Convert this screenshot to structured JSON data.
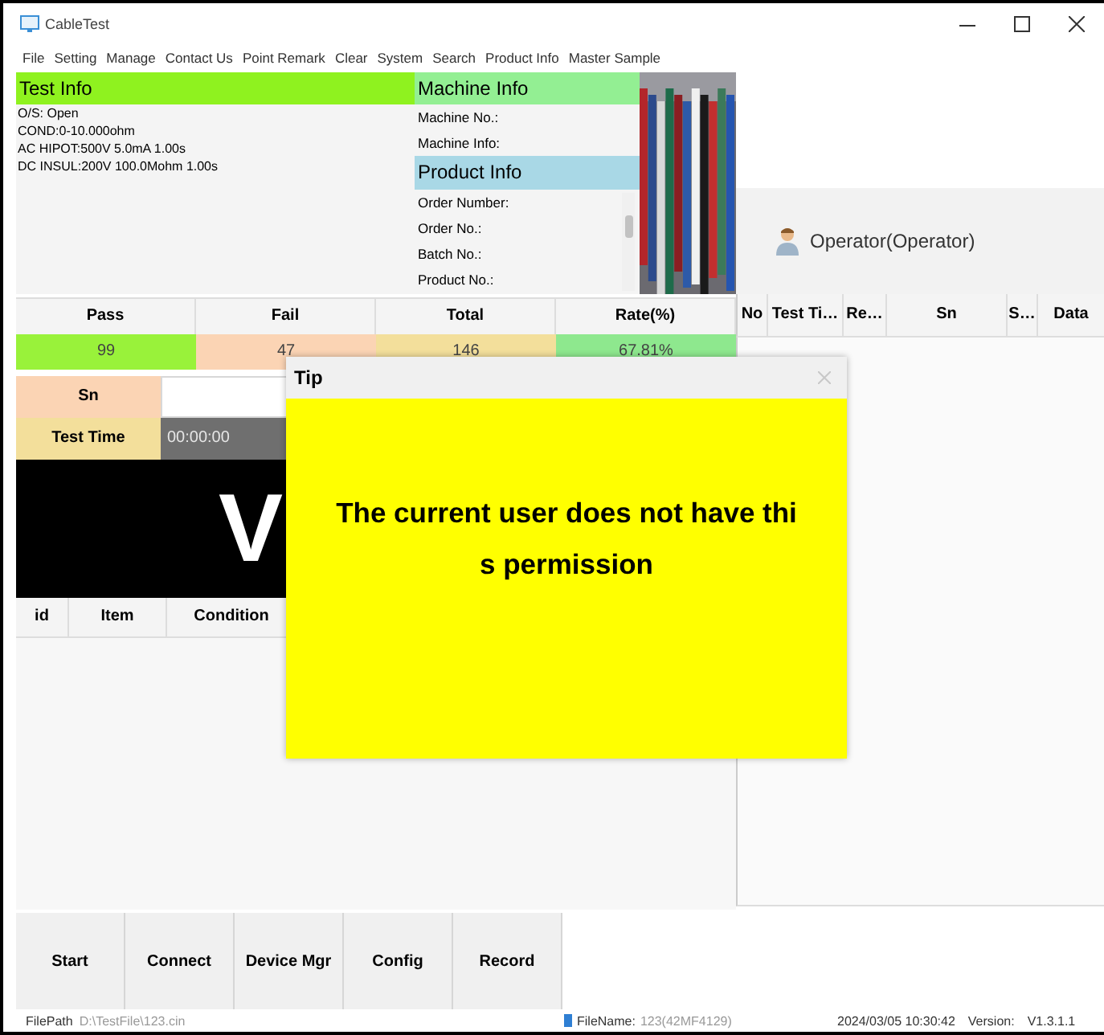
{
  "window": {
    "title": "CableTest"
  },
  "menu": [
    "File",
    "Setting",
    "Manage",
    "Contact Us",
    "Point Remark",
    "Clear",
    "System",
    "Search",
    "Product Info",
    "Master Sample"
  ],
  "test_info": {
    "title": "Test Info",
    "lines": [
      "O/S: Open",
      "COND:0-10.000ohm",
      "AC HIPOT:500V 5.0mA 1.00s",
      "DC INSUL:200V 100.0Mohm 1.00s"
    ]
  },
  "machine_info": {
    "title": "Machine Info",
    "lines": [
      "Machine No.:",
      "Machine Info:"
    ]
  },
  "product_info": {
    "title": "Product Info",
    "lines": [
      "Order Number:",
      "Order No.:",
      "Batch No.:",
      "Product No.:"
    ]
  },
  "photo": {
    "kind": "picture"
  },
  "operator": "Operator(Operator)",
  "stats": {
    "columns": [
      "Pass",
      "Fail",
      "Total",
      "Rate(%)"
    ],
    "values": [
      {
        "text": "99",
        "color": "#99f23a"
      },
      {
        "text": "47",
        "color": "#fbd4b4"
      },
      {
        "text": "146",
        "color": "#f3df9b"
      },
      {
        "text": "67.81%",
        "color": "#8ee88e"
      }
    ]
  },
  "sn": {
    "label": "Sn"
  },
  "test_time": {
    "label": "Test Time",
    "value": "00:00:00"
  },
  "result_banner": "V",
  "item_table": {
    "columns": [
      "id",
      "Item",
      "Condition"
    ]
  },
  "record_table": {
    "columns": [
      "No",
      "Test Ti…",
      "Re…",
      "Sn",
      "S…",
      "Data"
    ]
  },
  "buttons": [
    "Start",
    "Connect",
    "Device Mgr",
    "Config",
    "Record"
  ],
  "status_bar": {
    "file_path_label": "FilePath",
    "file_path": "D:\\TestFile\\123.cin",
    "file_name_label": "FileName:",
    "file_name": "123(42MF4129)",
    "datetime": "2024/03/05 10:30:42",
    "version_label": "Version:",
    "version": "V1.3.1.1"
  },
  "dialog": {
    "title": "Tip",
    "message_lines": [
      "The current user does not have thi",
      "s permission"
    ]
  }
}
